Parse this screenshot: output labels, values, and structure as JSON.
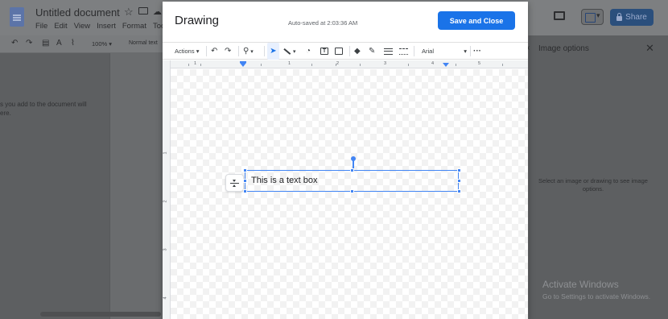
{
  "docs": {
    "doc_title": "Untitled document",
    "menu": [
      "File",
      "Edit",
      "View",
      "Insert",
      "Format",
      "Too"
    ],
    "zoom": "100%",
    "style": "Normal text",
    "left_hint": "s you add to the document will\nere.",
    "share_label": "Share"
  },
  "image_panel": {
    "title": "Image options",
    "hint": "Select an image or drawing to see image options."
  },
  "watermark": {
    "line1": "Activate Windows",
    "line2": "Go to Settings to activate Windows."
  },
  "dialog": {
    "title": "Drawing",
    "autosave": "Auto-saved at 2:03:36 AM",
    "save_close_label": "Save and Close",
    "toolbar": {
      "actions_label": "Actions",
      "font": "Arial"
    },
    "ruler_h": [
      "1",
      "1",
      "2",
      "3",
      "4",
      "5"
    ],
    "ruler_v": [
      "1",
      "2",
      "3",
      "4"
    ],
    "textbox_text": "This is a text box"
  },
  "colors": {
    "accent": "#1a73e8",
    "selection": "#4285f4"
  }
}
